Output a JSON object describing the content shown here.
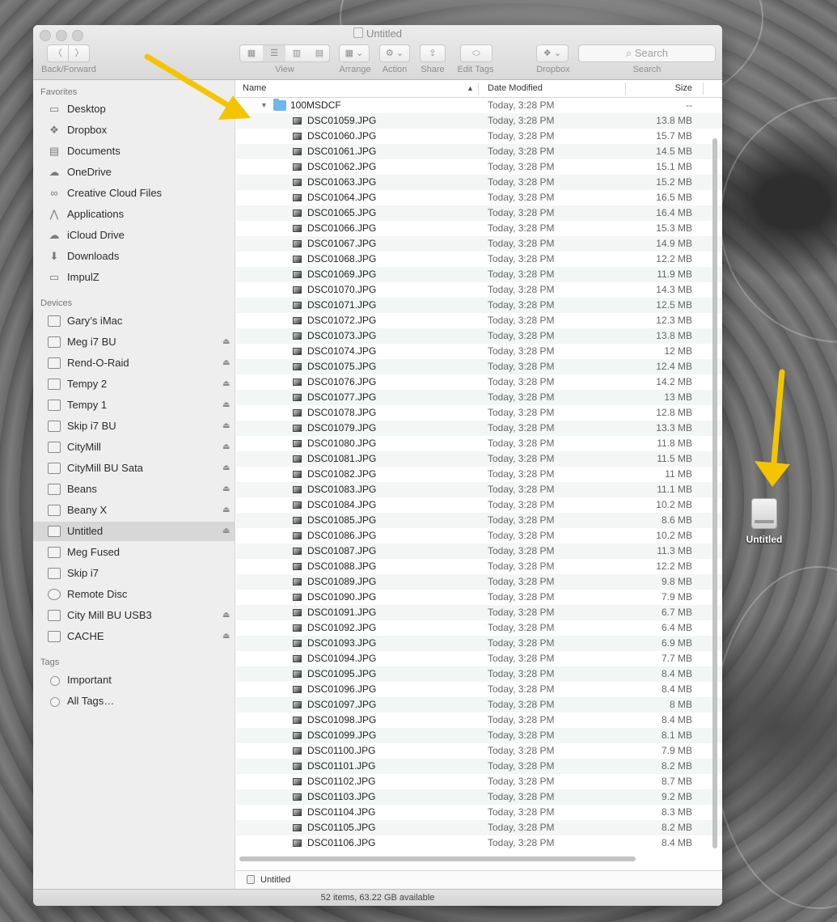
{
  "window": {
    "title": "Untitled",
    "toolbar": {
      "back_forward_label": "Back/Forward",
      "view_label": "View",
      "arrange_label": "Arrange",
      "action_label": "Action",
      "share_label": "Share",
      "edit_tags_label": "Edit Tags",
      "dropbox_label": "Dropbox",
      "search_label": "Search",
      "search_placeholder": "Search"
    }
  },
  "sidebar": {
    "favorites_header": "Favorites",
    "favorites": [
      {
        "label": "Desktop",
        "icon": "desktop-icon"
      },
      {
        "label": "Dropbox",
        "icon": "dropbox-icon"
      },
      {
        "label": "Documents",
        "icon": "documents-icon"
      },
      {
        "label": "OneDrive",
        "icon": "cloud-icon"
      },
      {
        "label": "Creative Cloud Files",
        "icon": "creative-cloud-icon"
      },
      {
        "label": "Applications",
        "icon": "applications-icon"
      },
      {
        "label": "iCloud Drive",
        "icon": "icloud-icon"
      },
      {
        "label": "Downloads",
        "icon": "downloads-icon"
      },
      {
        "label": "ImpulZ",
        "icon": "folder-icon"
      }
    ],
    "devices_header": "Devices",
    "devices": [
      {
        "label": "Gary’s iMac",
        "eject": false
      },
      {
        "label": "Meg i7 BU",
        "eject": true
      },
      {
        "label": "Rend-O-Raid",
        "eject": true
      },
      {
        "label": "Tempy 2",
        "eject": true
      },
      {
        "label": "Tempy 1",
        "eject": true
      },
      {
        "label": "Skip i7 BU",
        "eject": true
      },
      {
        "label": "CityMill",
        "eject": true
      },
      {
        "label": "CityMill BU Sata",
        "eject": true
      },
      {
        "label": "Beans",
        "eject": true
      },
      {
        "label": "Beany X",
        "eject": true
      },
      {
        "label": "Untitled",
        "eject": true,
        "selected": true
      },
      {
        "label": "Meg Fused",
        "eject": false
      },
      {
        "label": "Skip i7",
        "eject": false
      },
      {
        "label": "Remote Disc",
        "eject": false
      },
      {
        "label": "City Mill BU USB3",
        "eject": true
      },
      {
        "label": "CACHE",
        "eject": true
      }
    ],
    "tags_header": "Tags",
    "tags": [
      {
        "label": "Important"
      },
      {
        "label": "All Tags…"
      }
    ],
    "eject_glyph": "⏏"
  },
  "columns": {
    "name": "Name",
    "date": "Date Modified",
    "size": "Size"
  },
  "folder": {
    "name": "100MSDCF",
    "date": "Today, 3:28 PM",
    "size": "--"
  },
  "files": [
    {
      "name": "DSC01059.JPG",
      "date": "Today, 3:28 PM",
      "size": "13.8 MB"
    },
    {
      "name": "DSC01060.JPG",
      "date": "Today, 3:28 PM",
      "size": "15.7 MB"
    },
    {
      "name": "DSC01061.JPG",
      "date": "Today, 3:28 PM",
      "size": "14.5 MB"
    },
    {
      "name": "DSC01062.JPG",
      "date": "Today, 3:28 PM",
      "size": "15.1 MB"
    },
    {
      "name": "DSC01063.JPG",
      "date": "Today, 3:28 PM",
      "size": "15.2 MB"
    },
    {
      "name": "DSC01064.JPG",
      "date": "Today, 3:28 PM",
      "size": "16.5 MB"
    },
    {
      "name": "DSC01065.JPG",
      "date": "Today, 3:28 PM",
      "size": "16.4 MB"
    },
    {
      "name": "DSC01066.JPG",
      "date": "Today, 3:28 PM",
      "size": "15.3 MB"
    },
    {
      "name": "DSC01067.JPG",
      "date": "Today, 3:28 PM",
      "size": "14.9 MB"
    },
    {
      "name": "DSC01068.JPG",
      "date": "Today, 3:28 PM",
      "size": "12.2 MB"
    },
    {
      "name": "DSC01069.JPG",
      "date": "Today, 3:28 PM",
      "size": "11.9 MB"
    },
    {
      "name": "DSC01070.JPG",
      "date": "Today, 3:28 PM",
      "size": "14.3 MB"
    },
    {
      "name": "DSC01071.JPG",
      "date": "Today, 3:28 PM",
      "size": "12.5 MB"
    },
    {
      "name": "DSC01072.JPG",
      "date": "Today, 3:28 PM",
      "size": "12.3 MB"
    },
    {
      "name": "DSC01073.JPG",
      "date": "Today, 3:28 PM",
      "size": "13.8 MB"
    },
    {
      "name": "DSC01074.JPG",
      "date": "Today, 3:28 PM",
      "size": "12 MB"
    },
    {
      "name": "DSC01075.JPG",
      "date": "Today, 3:28 PM",
      "size": "12.4 MB"
    },
    {
      "name": "DSC01076.JPG",
      "date": "Today, 3:28 PM",
      "size": "14.2 MB"
    },
    {
      "name": "DSC01077.JPG",
      "date": "Today, 3:28 PM",
      "size": "13 MB"
    },
    {
      "name": "DSC01078.JPG",
      "date": "Today, 3:28 PM",
      "size": "12.8 MB"
    },
    {
      "name": "DSC01079.JPG",
      "date": "Today, 3:28 PM",
      "size": "13.3 MB"
    },
    {
      "name": "DSC01080.JPG",
      "date": "Today, 3:28 PM",
      "size": "11.8 MB"
    },
    {
      "name": "DSC01081.JPG",
      "date": "Today, 3:28 PM",
      "size": "11.5 MB"
    },
    {
      "name": "DSC01082.JPG",
      "date": "Today, 3:28 PM",
      "size": "11 MB"
    },
    {
      "name": "DSC01083.JPG",
      "date": "Today, 3:28 PM",
      "size": "11.1 MB"
    },
    {
      "name": "DSC01084.JPG",
      "date": "Today, 3:28 PM",
      "size": "10.2 MB"
    },
    {
      "name": "DSC01085.JPG",
      "date": "Today, 3:28 PM",
      "size": "8.6 MB"
    },
    {
      "name": "DSC01086.JPG",
      "date": "Today, 3:28 PM",
      "size": "10.2 MB"
    },
    {
      "name": "DSC01087.JPG",
      "date": "Today, 3:28 PM",
      "size": "11.3 MB"
    },
    {
      "name": "DSC01088.JPG",
      "date": "Today, 3:28 PM",
      "size": "12.2 MB"
    },
    {
      "name": "DSC01089.JPG",
      "date": "Today, 3:28 PM",
      "size": "9.8 MB"
    },
    {
      "name": "DSC01090.JPG",
      "date": "Today, 3:28 PM",
      "size": "7.9 MB"
    },
    {
      "name": "DSC01091.JPG",
      "date": "Today, 3:28 PM",
      "size": "6.7 MB"
    },
    {
      "name": "DSC01092.JPG",
      "date": "Today, 3:28 PM",
      "size": "6.4 MB"
    },
    {
      "name": "DSC01093.JPG",
      "date": "Today, 3:28 PM",
      "size": "6.9 MB"
    },
    {
      "name": "DSC01094.JPG",
      "date": "Today, 3:28 PM",
      "size": "7.7 MB"
    },
    {
      "name": "DSC01095.JPG",
      "date": "Today, 3:28 PM",
      "size": "8.4 MB"
    },
    {
      "name": "DSC01096.JPG",
      "date": "Today, 3:28 PM",
      "size": "8.4 MB"
    },
    {
      "name": "DSC01097.JPG",
      "date": "Today, 3:28 PM",
      "size": "8 MB"
    },
    {
      "name": "DSC01098.JPG",
      "date": "Today, 3:28 PM",
      "size": "8.4 MB"
    },
    {
      "name": "DSC01099.JPG",
      "date": "Today, 3:28 PM",
      "size": "8.1 MB"
    },
    {
      "name": "DSC01100.JPG",
      "date": "Today, 3:28 PM",
      "size": "7.9 MB"
    },
    {
      "name": "DSC01101.JPG",
      "date": "Today, 3:28 PM",
      "size": "8.2 MB"
    },
    {
      "name": "DSC01102.JPG",
      "date": "Today, 3:28 PM",
      "size": "8.7 MB"
    },
    {
      "name": "DSC01103.JPG",
      "date": "Today, 3:28 PM",
      "size": "9.2 MB"
    },
    {
      "name": "DSC01104.JPG",
      "date": "Today, 3:28 PM",
      "size": "8.3 MB"
    },
    {
      "name": "DSC01105.JPG",
      "date": "Today, 3:28 PM",
      "size": "8.2 MB"
    },
    {
      "name": "DSC01106.JPG",
      "date": "Today, 3:28 PM",
      "size": "8.4 MB"
    }
  ],
  "path_bar": {
    "label": "Untitled"
  },
  "status_bar": {
    "text": "52 items, 63.22 GB available"
  },
  "desktop": {
    "drive_label": "Untitled"
  },
  "colors": {
    "arrow": "#f5c400",
    "folder": "#6fb6ea",
    "selection": "#d7d7d7"
  }
}
